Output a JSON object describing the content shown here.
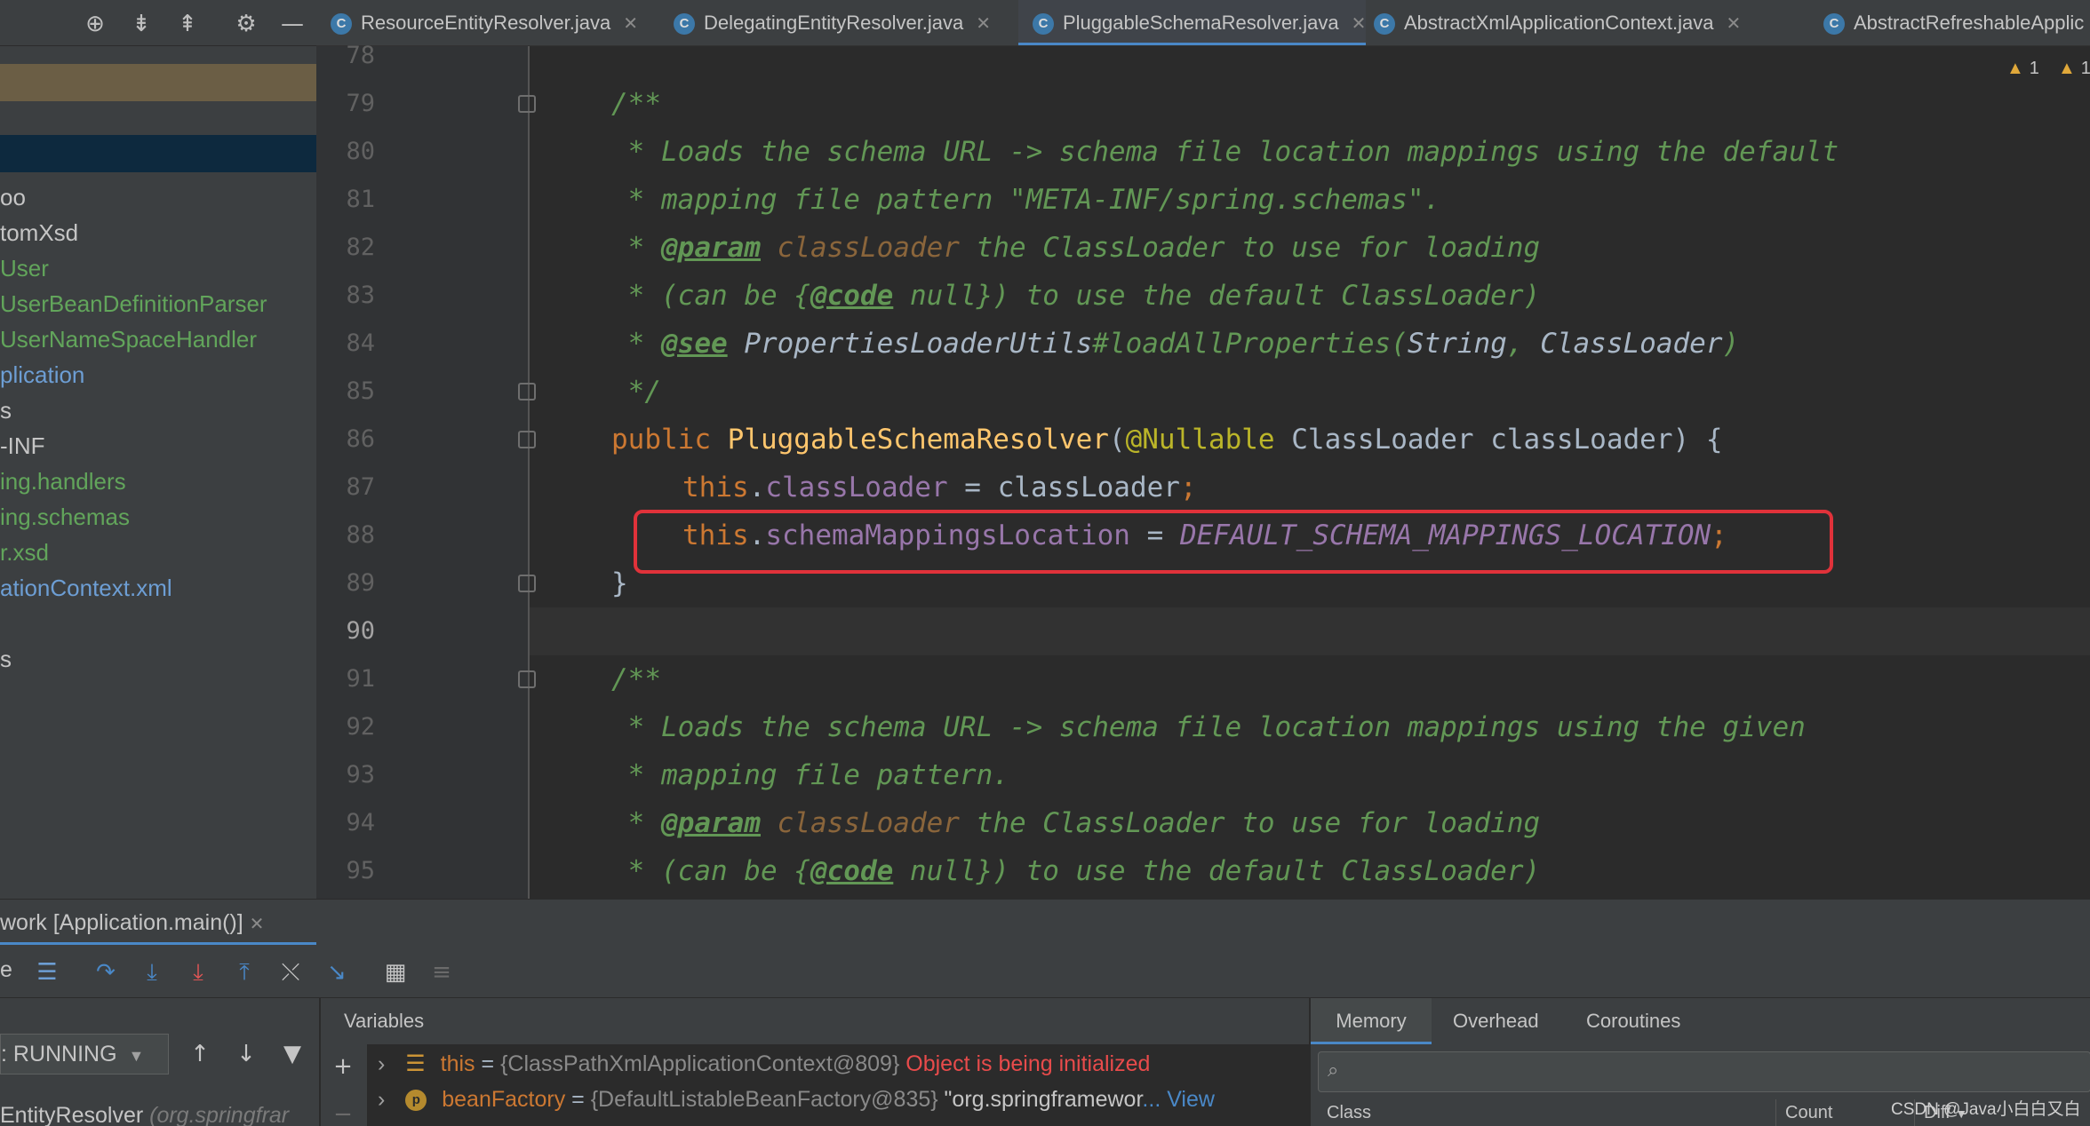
{
  "left_toolbar": {
    "icons": [
      "crosshair-icon",
      "expand-all-icon",
      "collapse-all-icon",
      "gear-icon",
      "minimize-icon"
    ]
  },
  "project_tree": [
    {
      "label": "oo",
      "style": "plain"
    },
    {
      "label": "tomXsd",
      "style": "plain"
    },
    {
      "label": "User",
      "style": "green"
    },
    {
      "label": "UserBeanDefinitionParser",
      "style": "green"
    },
    {
      "label": "UserNameSpaceHandler",
      "style": "green"
    },
    {
      "label": "plication",
      "style": "blue"
    },
    {
      "label": "s",
      "style": "plain"
    },
    {
      "label": "-INF",
      "style": "plain"
    },
    {
      "label": "ing.handlers",
      "style": "green"
    },
    {
      "label": "ing.schemas",
      "style": "green"
    },
    {
      "label": "r.xsd",
      "style": "green"
    },
    {
      "label": "ationContext.xml",
      "style": "blue"
    },
    {
      "label": "",
      "style": "plain"
    },
    {
      "label": "s",
      "style": "plain"
    }
  ],
  "tabs": [
    {
      "label": "ResourceEntityResolver.java",
      "active": false
    },
    {
      "label": "DelegatingEntityResolver.java",
      "active": false
    },
    {
      "label": "PluggableSchemaResolver.java",
      "active": true
    },
    {
      "label": "AbstractXmlApplicationContext.java",
      "active": false
    },
    {
      "label": "AbstractRefreshableApplic",
      "active": false
    }
  ],
  "inspections": {
    "warnings1": "1",
    "warnings2": "1"
  },
  "editor": {
    "line_numbers": [
      "78",
      "79",
      "80",
      "81",
      "82",
      "83",
      "84",
      "85",
      "86",
      "87",
      "88",
      "89",
      "90",
      "91",
      "92",
      "93",
      "94",
      "95"
    ],
    "current_line": "90",
    "code": {
      "l79": "/**",
      "l80": " * Loads the schema URL -> schema file location mappings using the default",
      "l81": " * mapping file pattern \"META-INF/spring.schemas\".",
      "l82_star": " * ",
      "l82_tag": "@param",
      "l82_ref": " classLoader",
      "l82_rest": " the ClassLoader to use for loading",
      "l83_a": " * (can be {",
      "l83_tag": "@code",
      "l83_b": " null}) to use the default ClassLoader)",
      "l84_star": " * ",
      "l84_tag": "@see",
      "l84_ref": " PropertiesLoaderUtils",
      "l84_b": "#loadAllProperties(",
      "l84_c": "String",
      "l84_d": ", ",
      "l84_e": "ClassLoader",
      "l84_f": ")",
      "l85": " */",
      "l86_kw": "public ",
      "l86_fn": "PluggableSchemaResolver",
      "l86_p1": "(",
      "l86_ann": "@Nullable",
      "l86_rest": " ClassLoader classLoader) {",
      "l87_kw": "this",
      "l87_dot": ".",
      "l87_fld": "classLoader",
      "l87_rest": " = classLoader",
      "l87_semi": ";",
      "l88_kw": "this",
      "l88_dot": ".",
      "l88_fld": "schemaMappingsLocation",
      "l88_eq": " = ",
      "l88_const": "DEFAULT_SCHEMA_MAPPINGS_LOCATION",
      "l88_semi": ";",
      "l89": "}",
      "l91": "/**",
      "l92": " * Loads the schema URL -> schema file location mappings using the given",
      "l93": " * mapping file pattern.",
      "l94_star": " * ",
      "l94_tag": "@param",
      "l94_ref": " classLoader",
      "l94_rest": " the ClassLoader to use for loading",
      "l95_a": " * (can be {",
      "l95_tag": "@code",
      "l95_b": " null}) to use the default ClassLoader)"
    }
  },
  "debug": {
    "session_tab": "work [Application.main()]",
    "frames_label_prefix": "e",
    "thread_status": ": RUNNING",
    "frame_item": "EntityResolver",
    "frame_item_pkg": "(org.springfrar",
    "variables_header": "Variables",
    "variables": [
      {
        "name": "this",
        "eq": " = ",
        "value": "{ClassPathXmlApplicationContext@809}",
        "extra": " Object is being initialized",
        "icon": "field-icon"
      },
      {
        "name": "beanFactory",
        "eq": " = ",
        "value": "{DefaultListableBeanFactory@835}",
        "extra": " \"org.springframewor",
        "link": "... View",
        "icon": "protected-field-icon"
      }
    ],
    "memory_tabs": [
      "Memory",
      "Overhead",
      "Coroutines"
    ],
    "memory_search_placeholder": "",
    "memory_columns": [
      "Class",
      "Count",
      "Diff"
    ]
  },
  "watermark": "CSDN @Java小白白又白",
  "colors": {
    "background": "#2b2b2b",
    "panel": "#3c3f41",
    "accent": "#4a88c7",
    "highlight_box": "#e0323a",
    "comment": "#629755",
    "keyword": "#cc7832",
    "function": "#ffc66d",
    "field": "#9876aa"
  }
}
